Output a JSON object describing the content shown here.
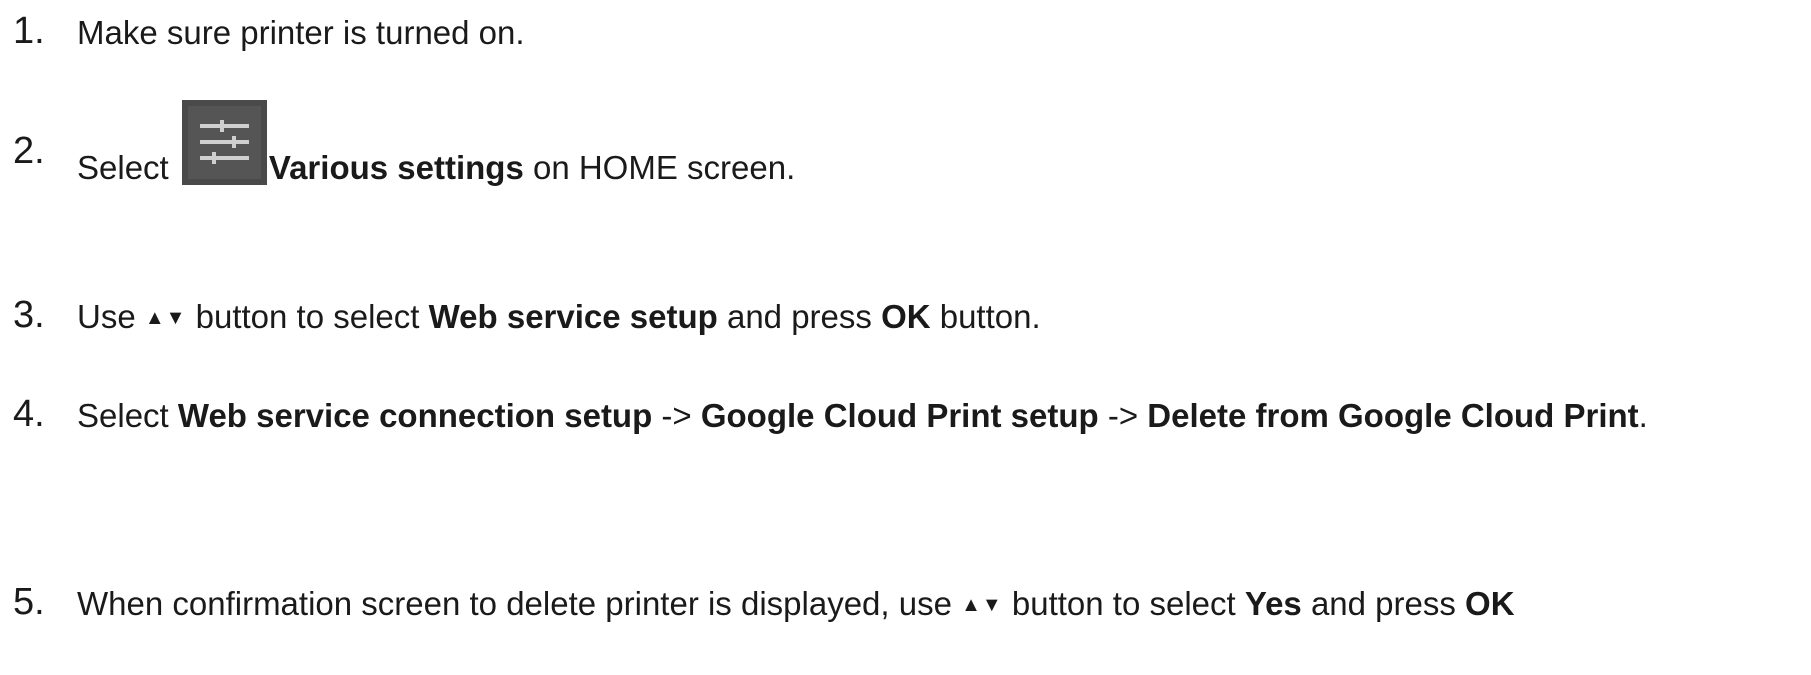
{
  "steps": [
    {
      "number": "1.",
      "text": "Make sure printer is turned on."
    },
    {
      "number": "2.",
      "pre": "Select ",
      "icon": "settings-sliders-icon",
      "bold1": "Various settings",
      "post": " on HOME screen."
    },
    {
      "number": "3.",
      "pre": "Use ",
      "arrows": "▲▼",
      "mid1": " button to select ",
      "bold1": "Web service setup",
      "mid2": " and press ",
      "bold2": "OK",
      "post": " button."
    },
    {
      "number": "4.",
      "pre": "Select ",
      "bold1": "Web service connection setup",
      "sep1": " -> ",
      "bold2": "Google Cloud Print setup",
      "sep2": " -> ",
      "bold3": "Delete from Google Cloud Print",
      "post": "."
    },
    {
      "number": "5.",
      "pre": "When confirmation screen to delete printer is displayed, use ",
      "arrows": "▲▼",
      "mid1": " button to select ",
      "bold1": "Yes",
      "mid2": " and press ",
      "bold2": "OK"
    }
  ],
  "icon_colors": {
    "background": "#4a4a4a",
    "lines": "#cfcfcf"
  }
}
